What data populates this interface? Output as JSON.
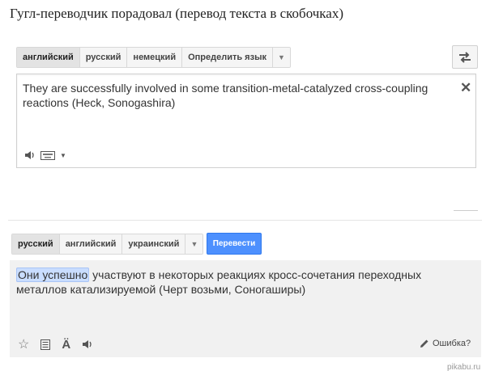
{
  "post": {
    "title": "Гугл-переводчик порадовал (перевод текста в скобочках)"
  },
  "source": {
    "languages": [
      "английский",
      "русский",
      "немецкий",
      "Определить язык"
    ],
    "active_index": 0,
    "text": "They are successfully involved in some transition-metal-catalyzed cross-coupling reactions (Heck, Sonogashira)"
  },
  "target": {
    "languages": [
      "русский",
      "английский",
      "украинский"
    ],
    "active_index": 0,
    "translate_label": "Перевести",
    "text_highlight": "Они успешно",
    "text_rest": " участвуют в некоторых реакциях кросс-сочетания переходных металлов катализируемой (Черт возьми, Соногаширы)",
    "feedback_label": "Ошибка?"
  },
  "watermark": "pikabu.ru",
  "colors": {
    "accent": "#4d90fe",
    "highlight": "#c9ddff",
    "target_bg": "#f1f1f1"
  },
  "icons": [
    "swap-icon",
    "close-icon",
    "speaker-icon",
    "keyboard-icon",
    "star-icon",
    "document-icon",
    "transliterate-icon",
    "pencil-icon"
  ]
}
